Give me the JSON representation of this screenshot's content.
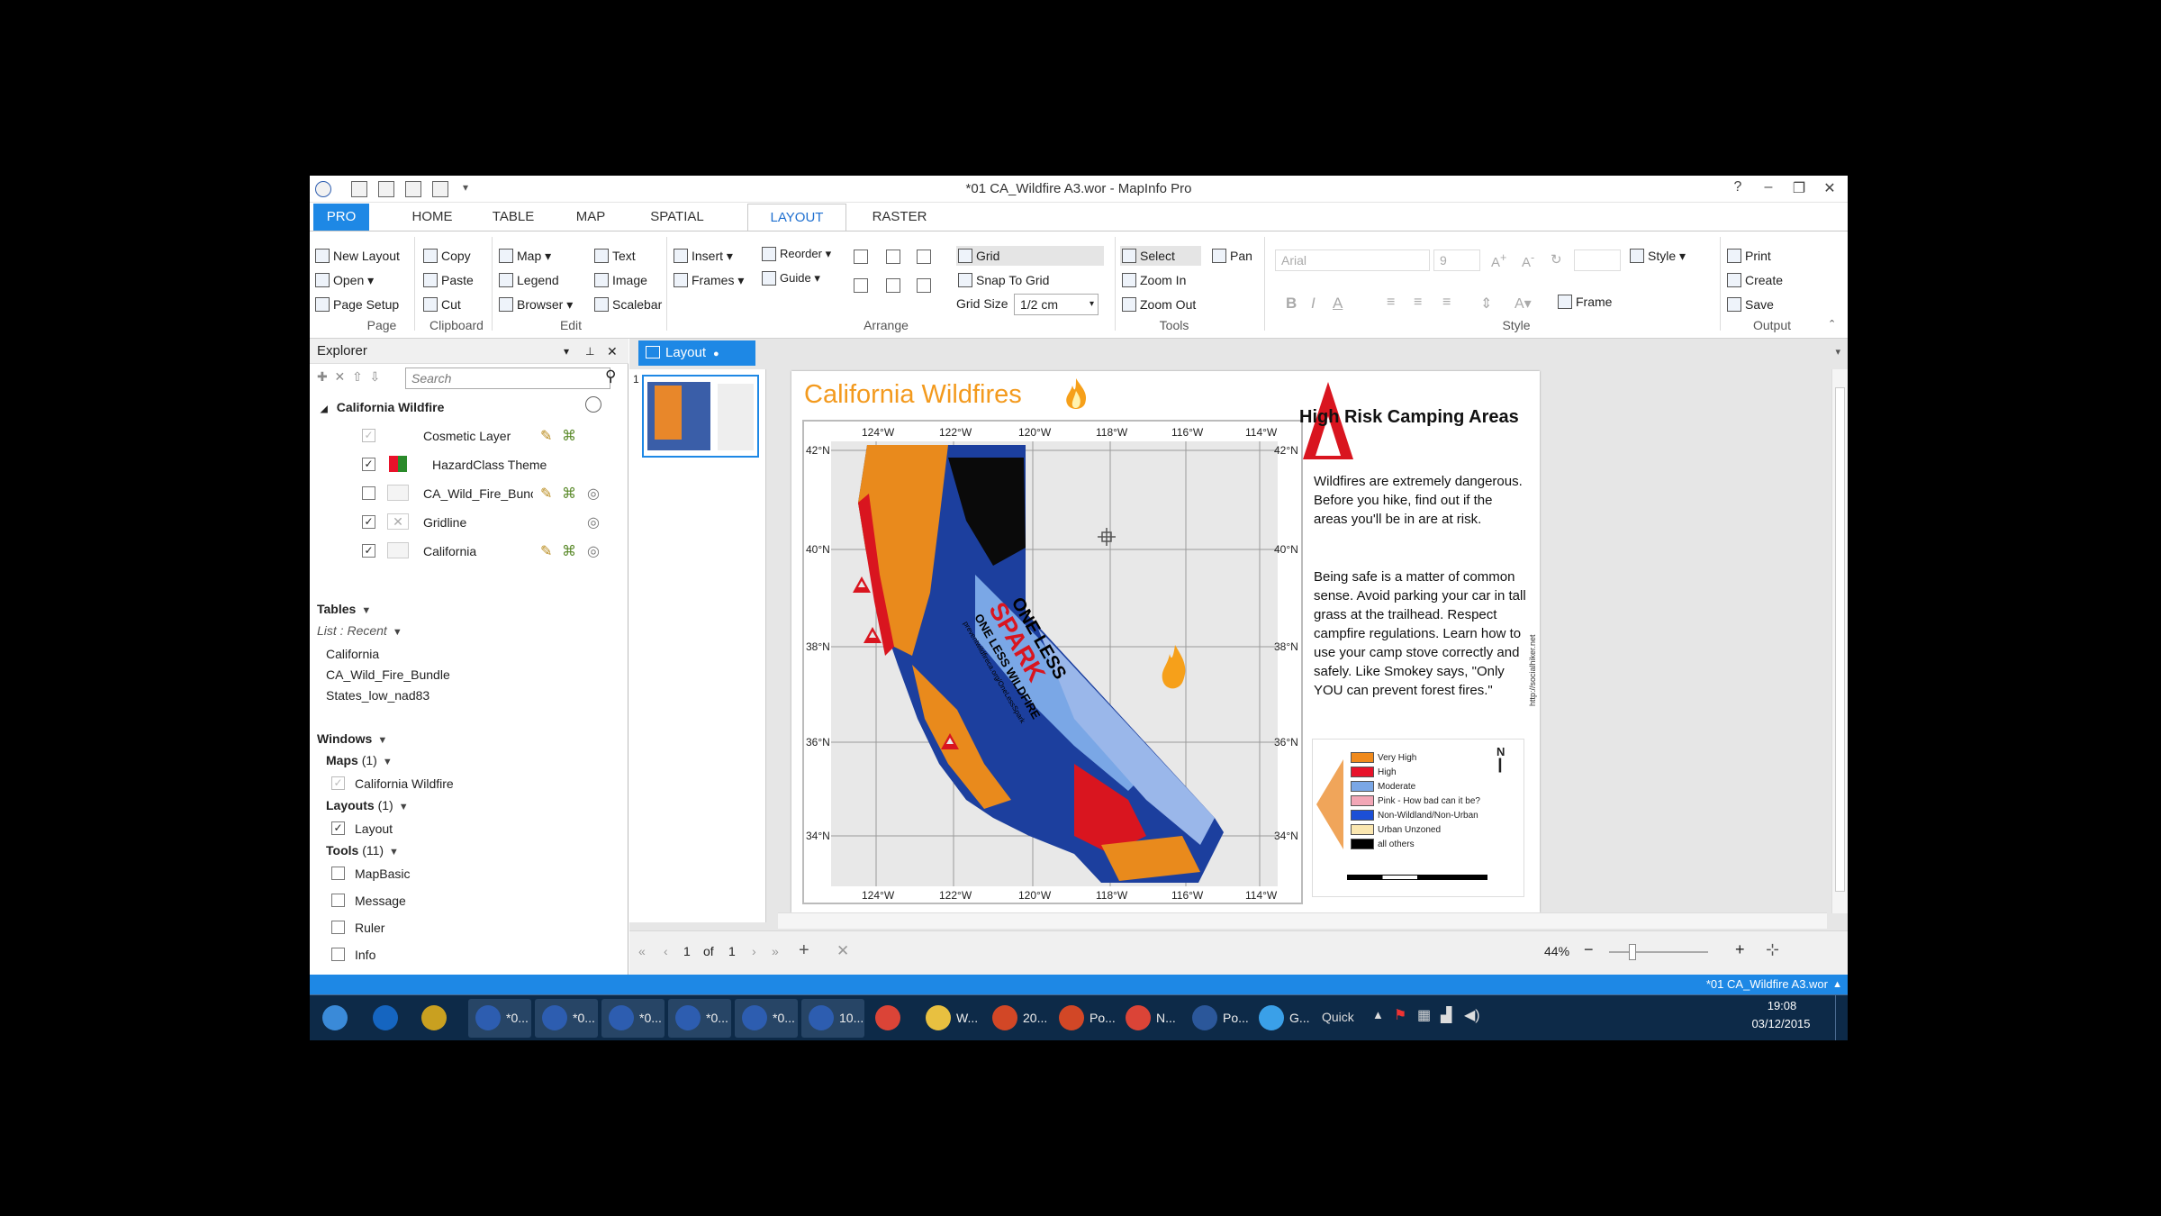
{
  "window": {
    "title": "*01 CA_Wildfire A3.wor - MapInfo Pro",
    "help": "?"
  },
  "tabs": [
    {
      "label": "PRO"
    },
    {
      "label": "HOME"
    },
    {
      "label": "TABLE"
    },
    {
      "label": "MAP"
    },
    {
      "label": "SPATIAL"
    },
    {
      "label": "LAYOUT"
    },
    {
      "label": "RASTER"
    }
  ],
  "ribbon": {
    "page": {
      "label": "Page",
      "new_layout": "New Layout",
      "open": "Open",
      "page_setup": "Page Setup"
    },
    "clipboard": {
      "label": "Clipboard",
      "copy": "Copy",
      "paste": "Paste",
      "cut": "Cut"
    },
    "edit": {
      "label": "Edit",
      "map": "Map",
      "legend": "Legend",
      "browser": "Browser",
      "text": "Text",
      "image": "Image",
      "scalebar": "Scalebar"
    },
    "arrange": {
      "label": "Arrange",
      "insert": "Insert",
      "frames": "Frames",
      "reorder": "Reorder",
      "guide": "Guide",
      "grid": "Grid",
      "snap_to_grid": "Snap To Grid",
      "grid_size_label": "Grid Size",
      "grid_size_value": "1/2 cm"
    },
    "tools": {
      "label": "Tools",
      "select": "Select",
      "pan": "Pan",
      "zoom_in": "Zoom In",
      "zoom_out": "Zoom Out"
    },
    "style": {
      "label": "Style",
      "font": "Arial",
      "size": "9",
      "frame": "Frame",
      "style_btn": "Style"
    },
    "output": {
      "label": "Output",
      "print": "Print",
      "create": "Create",
      "save": "Save"
    }
  },
  "explorer": {
    "title": "Explorer",
    "search_placeholder": "Search",
    "map_name": "California Wildfire",
    "layers": [
      {
        "name": "Cosmetic Layer",
        "checked": true
      },
      {
        "name": "HazardClass Theme",
        "checked": true
      },
      {
        "name": "CA_Wild_Fire_Bunc",
        "checked": false
      },
      {
        "name": "Gridline",
        "checked": true
      },
      {
        "name": "California",
        "checked": true
      }
    ],
    "tables_label": "Tables",
    "list_label": "List : Recent",
    "tables": [
      "California",
      "CA_Wild_Fire_Bundle",
      "States_low_nad83"
    ],
    "windows_label": "Windows",
    "maps_label": "Maps",
    "maps_count": "(1)",
    "maps_item": "California Wildfire",
    "layouts_label": "Layouts",
    "layouts_count": "(1)",
    "layouts_item": "Layout",
    "tools_label": "Tools",
    "tools_count": "(11)",
    "tools_items": [
      "MapBasic",
      "Message",
      "Ruler",
      "Info"
    ]
  },
  "layout": {
    "tab_label": "Layout",
    "thumb_number": "1",
    "title": "California Wildfires",
    "side_title": "High Risk Camping Areas",
    "para1": "Wildfires are extremely dangerous. Before you hike, find out if the areas you'll be in are at risk.",
    "para2": "Being safe is a matter of common sense. Avoid parking your car in tall grass at the trailhead. Respect campfire regulations. Learn how to use your camp stove correctly and safely. Like Smokey says, \"Only YOU can prevent forest fires.\"",
    "side_url": "http://socialhiker.net",
    "slogan1": "ONE LESS",
    "slogan2": "SPARK",
    "slogan3": "ONE LESS WILDFIRE",
    "slogan_url": "preventwildfireca.org/OneLessSpark",
    "lon_labels": [
      "124°W",
      "122°W",
      "120°W",
      "118°W",
      "116°W",
      "114°W"
    ],
    "lat_labels": [
      "42°N",
      "40°N",
      "38°N",
      "36°N",
      "34°N"
    ],
    "legend": [
      {
        "label": "Very High",
        "color": "#f08a1c"
      },
      {
        "label": "High",
        "color": "#e8122a"
      },
      {
        "label": "Moderate",
        "color": "#7aa7e6"
      },
      {
        "label": "Pink - How bad can it be?",
        "color": "#f2a6b6"
      },
      {
        "label": "Non-Wildland/Non-Urban",
        "color": "#1c4fd6"
      },
      {
        "label": "Urban Unzoned",
        "color": "#fbe7b0"
      },
      {
        "label": "all others",
        "color": "#000000"
      }
    ],
    "north": "N"
  },
  "nav": {
    "page": "1",
    "of": "of",
    "total": "1",
    "zoom": "44%"
  },
  "status": {
    "doc": "*01 CA_Wildfire A3.wor"
  },
  "taskbar": {
    "items": [
      {
        "label": "",
        "icon": "start-orb",
        "color": "#3a8ad8"
      },
      {
        "label": "",
        "icon": "outlook-icon",
        "color": "#1565c0"
      },
      {
        "label": "",
        "icon": "user-icon",
        "color": "#c9a020"
      },
      {
        "label": "*0...",
        "icon": "mapinfo-icon",
        "color": "#2d5db0"
      },
      {
        "label": "*0...",
        "icon": "mapinfo-icon",
        "color": "#2d5db0"
      },
      {
        "label": "*0...",
        "icon": "mapinfo-icon",
        "color": "#2d5db0"
      },
      {
        "label": "*0...",
        "icon": "mapinfo-icon",
        "color": "#2d5db0"
      },
      {
        "label": "*0...",
        "icon": "mapinfo-icon",
        "color": "#2d5db0"
      },
      {
        "label": "10...",
        "icon": "mapinfo-icon",
        "color": "#2d5db0"
      },
      {
        "label": "",
        "icon": "chrome-icon",
        "color": "#db4437"
      },
      {
        "label": "W...",
        "icon": "folder-icon",
        "color": "#e8c040"
      },
      {
        "label": "20...",
        "icon": "powerpoint-icon",
        "color": "#d24726"
      },
      {
        "label": "Po...",
        "icon": "powerpoint-icon",
        "color": "#d24726"
      },
      {
        "label": "N...",
        "icon": "chrome-icon",
        "color": "#db4437"
      },
      {
        "label": "Po...",
        "icon": "word-icon",
        "color": "#2b579a"
      },
      {
        "label": "G...",
        "icon": "app-icon",
        "color": "#3aa0e8"
      }
    ],
    "quick": "Quick",
    "time": "19:08",
    "date": "03/12/2015"
  }
}
